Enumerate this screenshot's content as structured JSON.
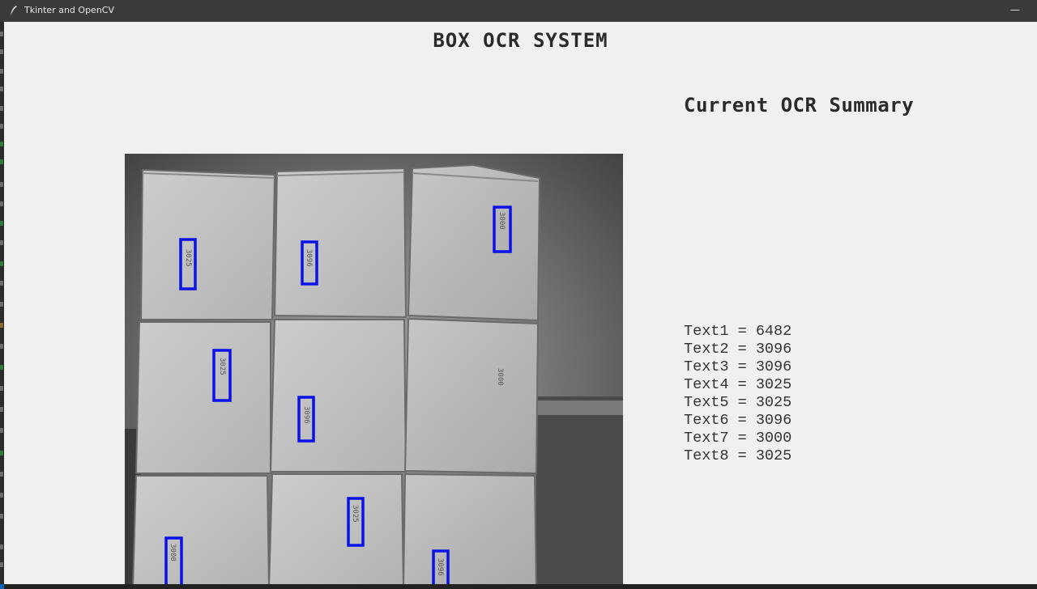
{
  "window": {
    "title": "Tkinter and OpenCV",
    "icon": "tk-feather-icon",
    "minimize_symbol": "—"
  },
  "app": {
    "heading": "BOX OCR SYSTEM",
    "summary_title": "Current OCR Summary"
  },
  "ocr_results": [
    {
      "label": "Text1",
      "value": "6482"
    },
    {
      "label": "Text2",
      "value": "3096"
    },
    {
      "label": "Text3",
      "value": "3096"
    },
    {
      "label": "Text4",
      "value": "3025"
    },
    {
      "label": "Text5",
      "value": "3025"
    },
    {
      "label": "Text6",
      "value": "3096"
    },
    {
      "label": "Text7",
      "value": "3000"
    },
    {
      "label": "Text8",
      "value": "3025"
    }
  ],
  "camera_view": {
    "box_labels": [
      "3025",
      "3096",
      "3000",
      "3025",
      "3096",
      "3000",
      "3000",
      "3025",
      "3096"
    ],
    "detection_color": "#0a12e6"
  }
}
